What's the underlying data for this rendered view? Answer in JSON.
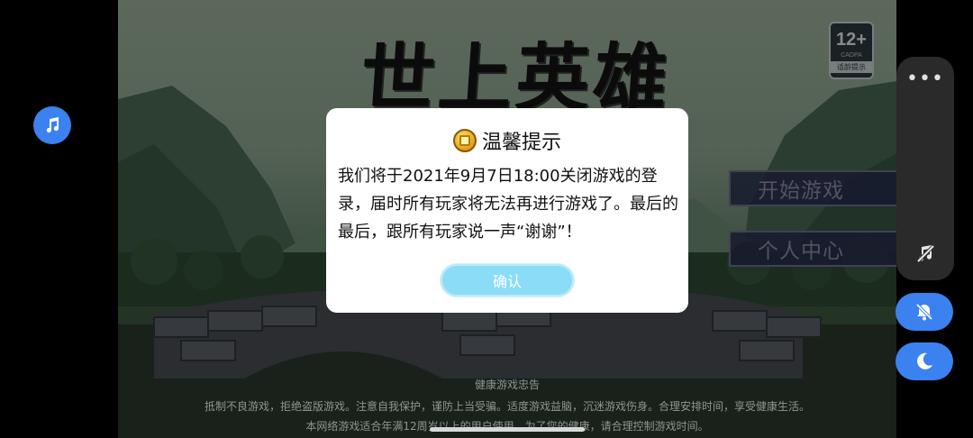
{
  "game": {
    "logo": "世上英雄",
    "age_rating": {
      "number": "12+",
      "org": "CADPA",
      "tip": "适龄提示"
    },
    "menu": {
      "start": "开始游戏",
      "personal_center": "个人中心"
    },
    "health_notice": {
      "title": "健康游戏忠告",
      "line1": "抵制不良游戏，拒绝盗版游戏。注意自我保护，谨防上当受骗。适度游戏益脑，沉迷游戏伤身。合理安排时间，享受健康生活。",
      "line2": "本网络游戏适合年满12周岁以上的用户使用，为了您的健康，请合理控制游戏时间。"
    }
  },
  "dialog": {
    "title": "温馨提示",
    "message": "我们将于2021年9月7日18:00关闭游戏的登录，届时所有玩家将无法再进行游戏了。最后的最后，跟所有玩家说一声“谢谢”！",
    "confirm_label": "确认"
  },
  "overlay": {
    "more": "•••",
    "icons": [
      "music-note-icon",
      "music-off-icon",
      "bell-off-icon",
      "moon-icon"
    ]
  },
  "colors": {
    "accent_blue": "#3b82f0",
    "confirm_button": "#8bdcf7",
    "dialog_bg": "#ffffff"
  }
}
